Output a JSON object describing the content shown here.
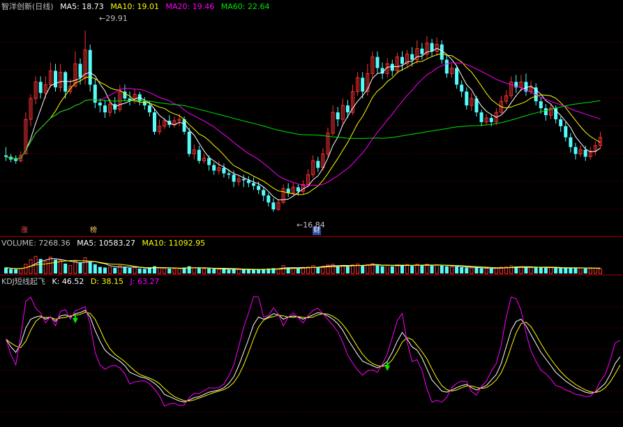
{
  "colors": {
    "up": "#ff3232",
    "down": "#54fcfc",
    "bg": "#000000",
    "grid": "#7f0000",
    "sep": "#b00000",
    "ma5": "#ffffff",
    "ma10": "#ffff00",
    "ma20": "#ff00ff",
    "ma60": "#00e600",
    "k": "#ffffff",
    "d": "#ffff00",
    "j": "#ff00ff",
    "signal": "#00e600"
  },
  "main_header": {
    "title": "智洋创新(日线)",
    "ma5": "MA5: 18.73",
    "ma10": "MA10: 19.01",
    "ma20": "MA20: 19.46",
    "ma60": "MA60: 22.64"
  },
  "volume_header": {
    "title": "VOLUME: 7268.36",
    "ma5": "MA5: 10583.27",
    "ma10": "MA10: 11092.95"
  },
  "kdj_header": {
    "title": "KDJ短线起飞",
    "k": "K: 46.52",
    "d": "D: 38.15",
    "j": "J: 63.27"
  },
  "annotations": {
    "high_label": "29.91",
    "low_label": "16.84",
    "badge_zhang": "涨",
    "badge_bang": "榜",
    "badge_cai": "财"
  },
  "chart_data": [
    {
      "type": "candlestick",
      "title": "智洋创新(日线)",
      "ylim": [
        16.0,
        31.0
      ],
      "note_high": 29.91,
      "note_low": 16.84,
      "candles": [
        [
          20.9,
          20.8,
          21.5,
          20.5
        ],
        [
          20.8,
          20.6,
          21.0,
          20.4
        ],
        [
          20.7,
          20.5,
          20.9,
          20.3
        ],
        [
          20.5,
          20.9,
          21.2,
          20.4
        ],
        [
          21.0,
          23.5,
          24.0,
          21.0
        ],
        [
          23.5,
          25.0,
          25.3,
          23.0
        ],
        [
          25.0,
          26.2,
          26.6,
          24.6
        ],
        [
          26.2,
          25.4,
          26.6,
          25.0
        ],
        [
          25.4,
          26.0,
          26.6,
          25.0
        ],
        [
          26.0,
          27.0,
          27.6,
          25.8
        ],
        [
          27.0,
          25.8,
          27.5,
          25.5
        ],
        [
          25.8,
          26.9,
          27.5,
          25.5
        ],
        [
          26.9,
          25.5,
          27.0,
          25.0
        ],
        [
          25.5,
          25.9,
          26.4,
          25.3
        ],
        [
          25.9,
          27.5,
          28.4,
          25.8
        ],
        [
          27.5,
          26.5,
          27.9,
          26.0
        ],
        [
          26.5,
          28.5,
          29.91,
          26.0
        ],
        [
          28.5,
          26.0,
          28.9,
          25.5
        ],
        [
          26.0,
          24.7,
          26.4,
          24.3
        ],
        [
          24.7,
          24.5,
          25.0,
          24.0
        ],
        [
          24.5,
          24.0,
          24.9,
          23.6
        ],
        [
          24.0,
          24.6,
          25.0,
          23.7
        ],
        [
          24.6,
          24.2,
          25.1,
          23.9
        ],
        [
          24.2,
          25.5,
          26.0,
          24.0
        ],
        [
          25.5,
          25.0,
          26.0,
          24.8
        ],
        [
          25.0,
          24.8,
          25.5,
          24.5
        ],
        [
          24.8,
          25.3,
          25.7,
          24.6
        ],
        [
          25.3,
          24.8,
          25.5,
          24.5
        ],
        [
          24.8,
          24.5,
          25.1,
          24.2
        ],
        [
          24.5,
          24.0,
          24.8,
          23.7
        ],
        [
          24.0,
          22.6,
          24.3,
          22.4
        ],
        [
          22.6,
          23.0,
          23.5,
          22.4
        ],
        [
          23.0,
          23.4,
          23.6,
          22.8
        ],
        [
          23.4,
          23.1,
          23.8,
          22.9
        ],
        [
          23.1,
          23.4,
          23.7,
          22.9
        ],
        [
          23.4,
          23.5,
          23.9,
          23.0
        ],
        [
          23.5,
          22.6,
          23.7,
          22.4
        ],
        [
          22.6,
          21.0,
          22.9,
          20.8
        ],
        [
          21.0,
          21.3,
          21.7,
          20.6
        ],
        [
          21.3,
          20.5,
          21.6,
          20.3
        ],
        [
          20.5,
          20.7,
          21.0,
          20.3
        ],
        [
          20.7,
          20.2,
          20.9,
          19.8
        ],
        [
          20.2,
          19.8,
          20.4,
          19.5
        ],
        [
          19.8,
          20.0,
          20.5,
          19.5
        ],
        [
          20.0,
          19.6,
          20.3,
          19.3
        ],
        [
          19.6,
          19.5,
          19.9,
          19.2
        ],
        [
          19.5,
          19.0,
          19.8,
          18.6
        ],
        [
          19.0,
          19.2,
          19.5,
          18.7
        ],
        [
          19.2,
          19.1,
          19.5,
          18.6
        ],
        [
          19.1,
          18.9,
          19.4,
          18.6
        ],
        [
          18.9,
          18.7,
          19.3,
          18.4
        ],
        [
          18.7,
          18.4,
          19.0,
          18.1
        ],
        [
          18.4,
          18.0,
          18.6,
          17.6
        ],
        [
          18.0,
          17.5,
          18.2,
          17.2
        ],
        [
          17.5,
          17.0,
          17.8,
          16.84
        ],
        [
          17.0,
          17.5,
          17.7,
          16.9
        ],
        [
          17.5,
          18.5,
          18.8,
          17.4
        ],
        [
          18.5,
          18.2,
          18.9,
          17.9
        ],
        [
          18.2,
          18.6,
          18.9,
          18.0
        ],
        [
          18.6,
          18.3,
          18.8,
          18.0
        ],
        [
          18.3,
          18.8,
          19.1,
          18.1
        ],
        [
          18.8,
          19.5,
          19.9,
          18.6
        ],
        [
          19.5,
          20.5,
          20.9,
          19.3
        ],
        [
          20.5,
          20.0,
          20.8,
          19.7
        ],
        [
          20.0,
          21.0,
          21.4,
          19.8
        ],
        [
          21.0,
          22.5,
          22.9,
          20.8
        ],
        [
          22.5,
          24.0,
          24.5,
          22.3
        ],
        [
          24.0,
          23.5,
          24.4,
          23.0
        ],
        [
          23.5,
          24.5,
          25.0,
          23.2
        ],
        [
          24.5,
          24.0,
          24.9,
          23.6
        ],
        [
          24.0,
          25.5,
          26.0,
          23.8
        ],
        [
          25.5,
          26.5,
          26.9,
          25.2
        ],
        [
          26.5,
          25.5,
          26.9,
          25.0
        ],
        [
          25.5,
          26.8,
          27.5,
          25.2
        ],
        [
          26.8,
          28.0,
          28.4,
          26.5
        ],
        [
          28.0,
          27.2,
          28.4,
          26.8
        ],
        [
          27.2,
          26.8,
          27.6,
          26.4
        ],
        [
          26.8,
          27.5,
          27.9,
          26.5
        ],
        [
          27.5,
          27.0,
          27.8,
          26.6
        ],
        [
          27.0,
          28.0,
          28.3,
          26.8
        ],
        [
          28.0,
          27.5,
          28.4,
          27.0
        ],
        [
          27.5,
          28.2,
          28.5,
          27.2
        ],
        [
          28.2,
          27.8,
          28.7,
          27.3
        ],
        [
          27.8,
          28.6,
          29.2,
          27.5
        ],
        [
          28.6,
          28.2,
          29.0,
          27.8
        ],
        [
          28.2,
          29.0,
          29.5,
          27.9
        ],
        [
          29.0,
          28.4,
          29.3,
          28.0
        ],
        [
          28.4,
          28.9,
          29.4,
          28.1
        ],
        [
          28.9,
          27.8,
          29.2,
          27.5
        ],
        [
          27.8,
          26.8,
          28.1,
          26.5
        ],
        [
          26.8,
          27.2,
          27.5,
          26.5
        ],
        [
          27.2,
          26.0,
          27.4,
          25.7
        ],
        [
          26.0,
          25.5,
          26.3,
          25.1
        ],
        [
          25.5,
          24.5,
          25.8,
          24.2
        ],
        [
          24.5,
          25.0,
          25.4,
          24.1
        ],
        [
          25.0,
          24.0,
          25.2,
          23.7
        ],
        [
          24.0,
          23.3,
          24.2,
          23.0
        ],
        [
          23.3,
          23.6,
          23.9,
          23.1
        ],
        [
          23.6,
          23.3,
          23.8,
          23.0
        ],
        [
          23.3,
          24.0,
          24.3,
          23.1
        ],
        [
          24.0,
          24.8,
          25.2,
          23.9
        ],
        [
          24.8,
          25.2,
          25.6,
          24.6
        ],
        [
          25.2,
          26.2,
          26.6,
          25.0
        ],
        [
          26.2,
          25.8,
          26.7,
          25.4
        ],
        [
          25.8,
          26.2,
          26.7,
          25.5
        ],
        [
          26.2,
          25.5,
          26.8,
          25.2
        ],
        [
          25.5,
          25.8,
          26.3,
          25.3
        ],
        [
          25.8,
          24.8,
          26.1,
          24.5
        ],
        [
          24.8,
          24.3,
          25.1,
          23.9
        ],
        [
          24.3,
          23.8,
          24.6,
          23.4
        ],
        [
          23.8,
          24.3,
          24.6,
          23.5
        ],
        [
          24.3,
          23.5,
          24.5,
          23.2
        ],
        [
          23.5,
          23.0,
          23.7,
          22.6
        ],
        [
          23.0,
          22.2,
          23.3,
          21.9
        ],
        [
          22.2,
          21.5,
          22.5,
          21.1
        ],
        [
          21.5,
          21.0,
          21.8,
          20.6
        ],
        [
          21.0,
          21.3,
          21.6,
          20.8
        ],
        [
          21.3,
          20.8,
          21.6,
          20.5
        ],
        [
          20.8,
          21.2,
          21.5,
          20.6
        ],
        [
          21.2,
          21.6,
          21.9,
          20.9
        ],
        [
          21.6,
          22.2,
          22.6,
          21.4
        ]
      ]
    },
    {
      "type": "bar",
      "title": "VOLUME",
      "ylim": [
        0,
        38000
      ],
      "values": [
        9000,
        7000,
        6500,
        7500,
        14000,
        21000,
        26000,
        22000,
        18000,
        25000,
        21000,
        20000,
        15000,
        12000,
        19000,
        16000,
        24000,
        17000,
        14000,
        10000,
        9000,
        9500,
        8500,
        12000,
        10000,
        8500,
        9000,
        7500,
        7000,
        8000,
        11000,
        9000,
        8000,
        7500,
        7200,
        7500,
        9000,
        11000,
        8500,
        8000,
        7000,
        7500,
        7200,
        6500,
        6800,
        6000,
        6500,
        6200,
        6000,
        5800,
        5600,
        6200,
        7000,
        7500,
        8000,
        7000,
        12000,
        9000,
        8500,
        7500,
        9000,
        10000,
        12000,
        9500,
        11000,
        13000,
        14000,
        11000,
        12000,
        10500,
        13000,
        14500,
        12000,
        13500,
        15000,
        12000,
        11000,
        12500,
        11000,
        13000,
        12000,
        13500,
        11500,
        14000,
        12500,
        14000,
        12000,
        13000,
        12000,
        11000,
        10000,
        10500,
        9500,
        9000,
        8500,
        9000,
        8000,
        7800,
        7500,
        8000,
        9500,
        10000,
        11500,
        10500,
        10000,
        9500,
        9000,
        9500,
        9000,
        8500,
        8800,
        8200,
        8000,
        8500,
        9000,
        8500,
        8200,
        7800,
        7500,
        8000,
        7268
      ]
    },
    {
      "type": "line",
      "title": "KDJ短线起飞",
      "ylim": [
        -15,
        110
      ],
      "k_values": [
        62,
        55,
        50,
        58,
        72,
        80,
        82,
        83,
        80,
        82,
        78,
        83,
        84,
        82,
        85,
        86,
        88,
        82,
        70,
        60,
        52,
        48,
        45,
        42,
        38,
        32,
        30,
        28,
        27,
        25,
        22,
        18,
        12,
        10,
        8,
        6,
        5,
        7,
        9,
        10,
        12,
        14,
        15,
        16,
        18,
        22,
        28,
        38,
        50,
        62,
        75,
        82,
        80,
        82,
        85,
        84,
        80,
        82,
        83,
        82,
        80,
        82,
        84,
        86,
        85,
        83,
        80,
        76,
        70,
        62,
        55,
        48,
        42,
        40,
        38,
        36,
        38,
        42,
        50,
        60,
        68,
        62,
        55,
        52,
        45,
        35,
        25,
        20,
        15,
        14,
        16,
        18,
        20,
        21,
        18,
        16,
        18,
        20,
        25,
        30,
        40,
        55,
        70,
        78,
        80,
        74,
        66,
        58,
        50,
        44,
        38,
        32,
        28,
        24,
        21,
        18,
        16,
        14,
        13,
        14,
        18,
        22,
        30,
        40,
        46
      ]
    }
  ]
}
